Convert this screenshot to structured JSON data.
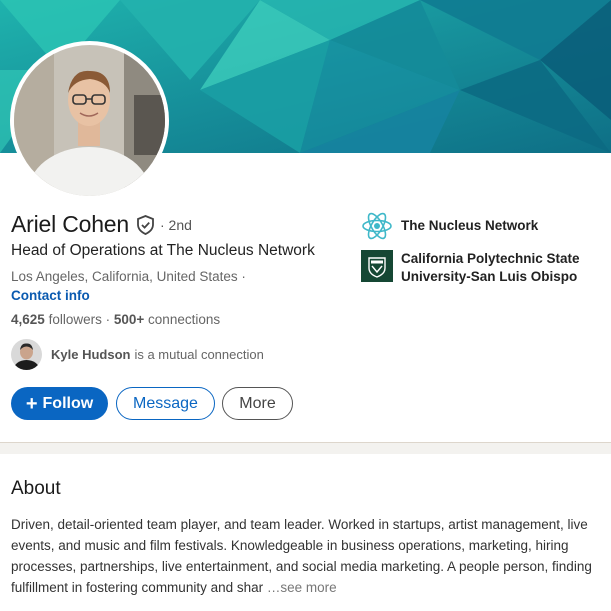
{
  "profile": {
    "name": "Ariel Cohen",
    "degree": "· 2nd",
    "headline": "Head of Operations at The Nucleus Network",
    "location": "Los Angeles, California, United States ·",
    "contact_info_label": "Contact info",
    "followers_count": "4,625",
    "followers_label": "followers",
    "connections_count": "500+",
    "connections_label": "connections",
    "mutual_name": "Kyle Hudson",
    "mutual_text": "is a mutual connection"
  },
  "actions": {
    "follow_label": "Follow",
    "follow_icon": "+",
    "message_label": "Message",
    "more_label": "More"
  },
  "organizations": [
    {
      "name": "The Nucleus Network",
      "icon": "atom-icon"
    },
    {
      "name_line1": "California Polytechnic State",
      "name_line2": "University-San Luis Obispo",
      "icon": "cal-poly-logo"
    }
  ],
  "about": {
    "title": "About",
    "text": "Driven, detail-oriented team player, and team leader. Worked in startups, artist management, live events, and music and film festivals. Knowledgeable in business operations, marketing, hiring processes, partnerships, live entertainment, and social media marketing. A people person, finding fulfillment in fostering community and shar",
    "see_more": "…see more"
  },
  "colors": {
    "brand_blue": "#0a66c2",
    "banner_teal": "#1aa8a8",
    "cal_poly_green": "#154734"
  }
}
